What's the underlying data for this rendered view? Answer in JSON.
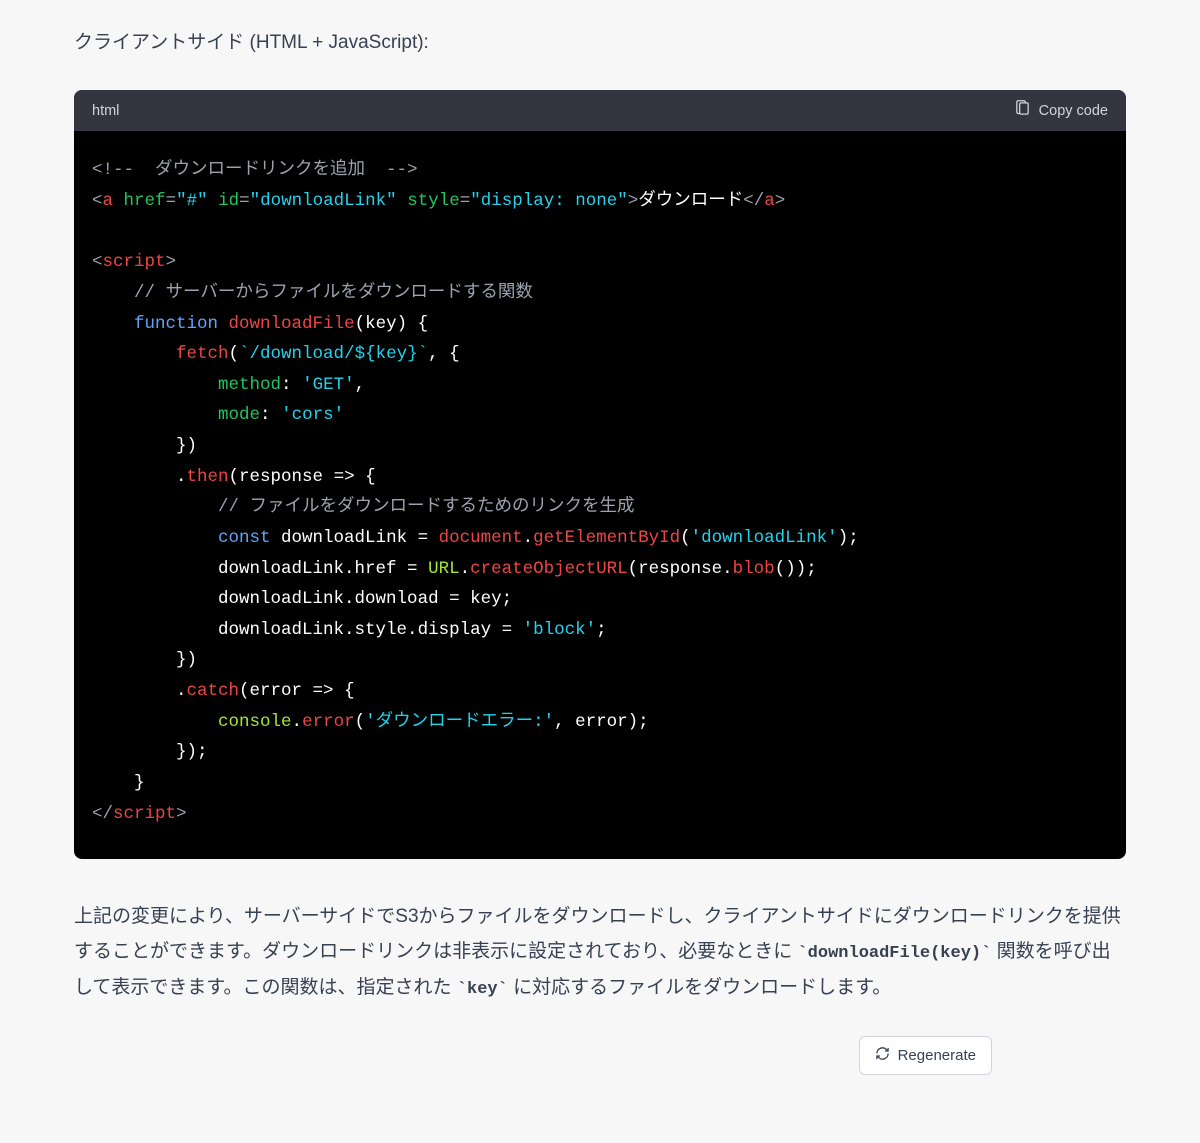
{
  "intro": "クライアントサイド (HTML + JavaScript):",
  "code_block": {
    "language": "html",
    "copy_label": "Copy code",
    "lines": {
      "l01_comment_open": "<!-- ",
      "l01_comment_text": " ダウンロードリンクを追加 ",
      "l01_comment_close": " -->",
      "l02_tag_a_open": "a",
      "l02_attr_href": "href",
      "l02_val_href": "\"#\"",
      "l02_attr_id": "id",
      "l02_val_id": "\"downloadLink\"",
      "l02_attr_style": "style",
      "l02_val_style": "\"display: none\"",
      "l02_text": "ダウンロード",
      "l02_tag_close": "a",
      "l04_tag_script": "script",
      "l05_comment": "// サーバーからファイルをダウンロードする関数",
      "l06_kw_function": "function",
      "l06_fn_name": "downloadFile",
      "l06_params": "(key) {",
      "l07_fn_fetch": "fetch",
      "l07_tpl": "`/download/${key}`",
      "l07_rest": ", {",
      "l08_prop_method": "method",
      "l08_colon": ": ",
      "l08_val": "'GET'",
      "l08_comma": ",",
      "l09_prop_mode": "mode",
      "l09_colon": ": ",
      "l09_val": "'cors'",
      "l10_close": "})",
      "l11_dot": ".",
      "l11_then": "then",
      "l11_rest": "(response => {",
      "l12_comment": "// ファイルをダウンロードするためのリンクを生成",
      "l13_kw_const": "const",
      "l13_name": " downloadLink = ",
      "l13_doc": "document",
      "l13_dot": ".",
      "l13_ge": "getElementById",
      "l13_open": "(",
      "l13_arg": "'downloadLink'",
      "l13_close": ");",
      "l14_left": "downloadLink.href = ",
      "l14_url": "URL",
      "l14_dot": ".",
      "l14_cou": "createObjectURL",
      "l14_open": "(response.",
      "l14_blob": "blob",
      "l14_close": "());",
      "l15": "downloadLink.download = key;",
      "l16_left": "downloadLink.style.display = ",
      "l16_val": "'block'",
      "l16_semi": ";",
      "l17_close": "})",
      "l18_dot": ".",
      "l18_catch": "catch",
      "l18_rest": "(error => {",
      "l19_console": "console",
      "l19_dot": ".",
      "l19_error": "error",
      "l19_open": "(",
      "l19_arg": "'ダウンロードエラー:'",
      "l19_rest": ", error);",
      "l20_close": "});",
      "l21_brace": "}",
      "l22_close_script": "script"
    }
  },
  "outro": {
    "p1a": "上記の変更により、サーバーサイドでS3からファイルをダウンロードし、クライアントサイドにダウンロードリンクを提供することができます。ダウンロードリンクは非表示に設定されており、必要なときに ",
    "code1": "`downloadFile(key)`",
    "p1b": " 関数を呼び出して表示できます。この関数は、指定された ",
    "code2": "`key`",
    "p1c": " に対応するファイルをダウンロードします。"
  },
  "regenerate_label": "Regenerate"
}
